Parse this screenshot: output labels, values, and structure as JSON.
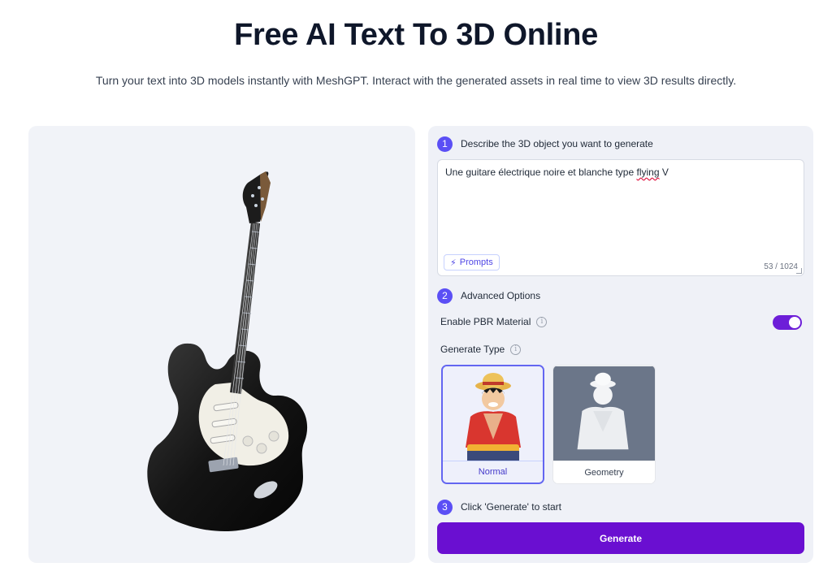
{
  "header": {
    "title": "Free AI Text To 3D Online",
    "subtitle": "Turn your text into 3D models instantly with MeshGPT. Interact with the generated assets in real time to view 3D results directly."
  },
  "steps": [
    {
      "num": "1",
      "label": "Describe the 3D object you want to generate"
    },
    {
      "num": "2",
      "label": "Advanced Options"
    },
    {
      "num": "3",
      "label": "Click 'Generate' to start"
    }
  ],
  "prompt": {
    "value_before": "Une guitare électrique noire et blanche type ",
    "value_misspelled": "flying",
    "value_after": " V",
    "prompts_label": "Prompts",
    "char_count": "53 / 1024"
  },
  "options": {
    "pbr_label": "Enable PBR Material",
    "pbr_enabled": true,
    "generate_type_label": "Generate Type",
    "types": [
      {
        "label": "Normal",
        "selected": true
      },
      {
        "label": "Geometry",
        "selected": false
      }
    ]
  },
  "generate_label": "Generate",
  "colors": {
    "accent": "#6a0fd1",
    "step_badge": "#5b4ff5",
    "selected_border": "#6366f1"
  }
}
